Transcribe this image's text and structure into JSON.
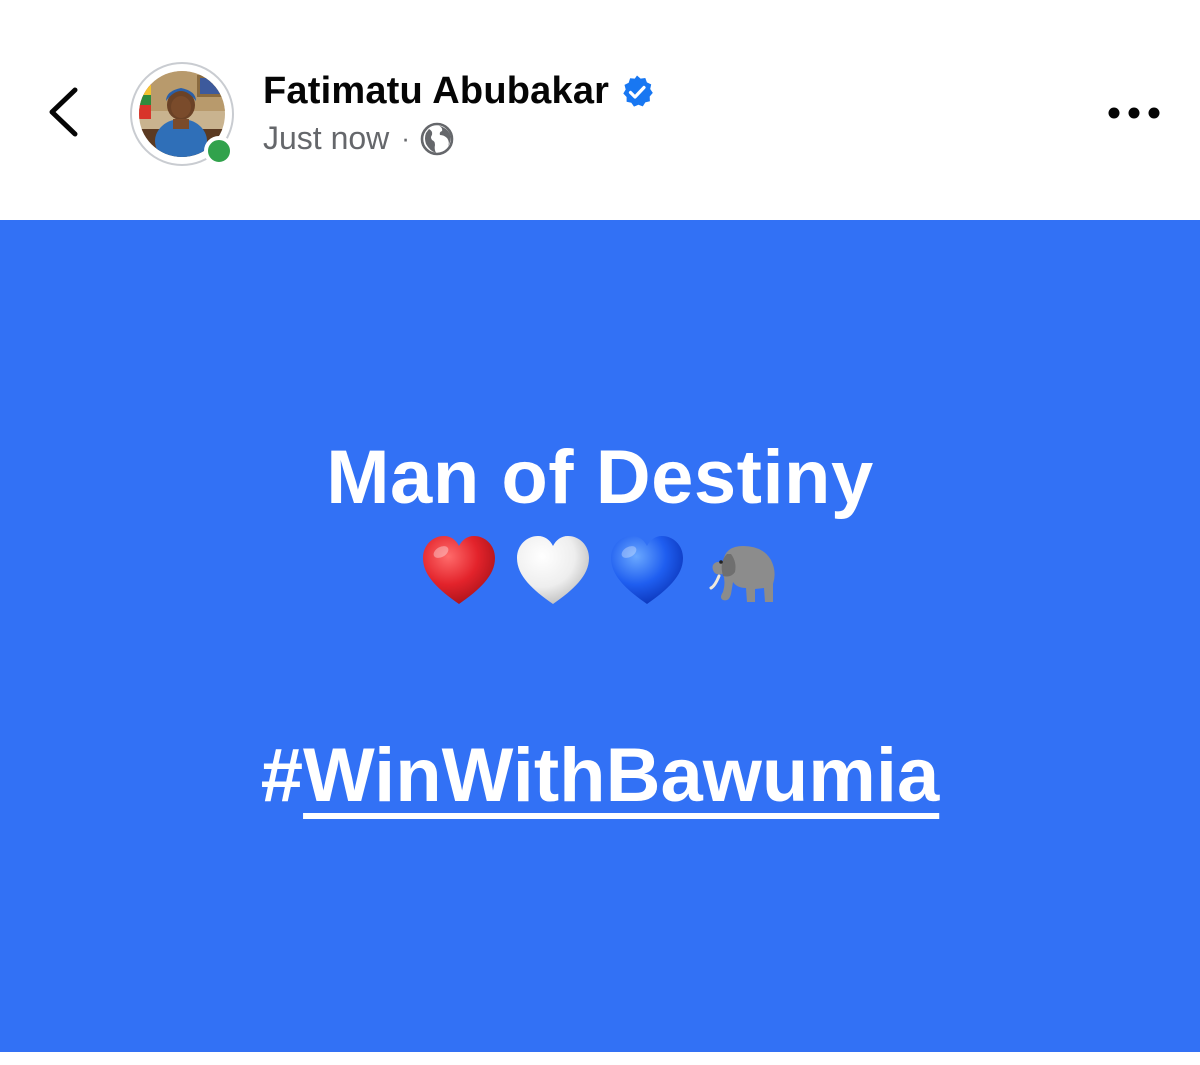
{
  "header": {
    "author_name": "Fatimatu Abubakar",
    "timestamp": "Just now",
    "separator": "·",
    "privacy_icon": "globe-icon",
    "verified_icon": "verified-badge-icon",
    "back_icon": "chevron-left-icon",
    "more_icon": "more-horizontal-icon",
    "online_status": "online"
  },
  "post": {
    "title": "Man of Destiny",
    "emojis": [
      "red-heart",
      "white-heart",
      "blue-heart",
      "elephant"
    ],
    "hashtag_prefix": "#",
    "hashtag_text": "WinWithBawumia",
    "background_color": "#3271f5"
  },
  "colors": {
    "accent_blue": "#1877f2",
    "online_green": "#31a24c",
    "text_primary": "#050505",
    "text_secondary": "#65676b"
  }
}
